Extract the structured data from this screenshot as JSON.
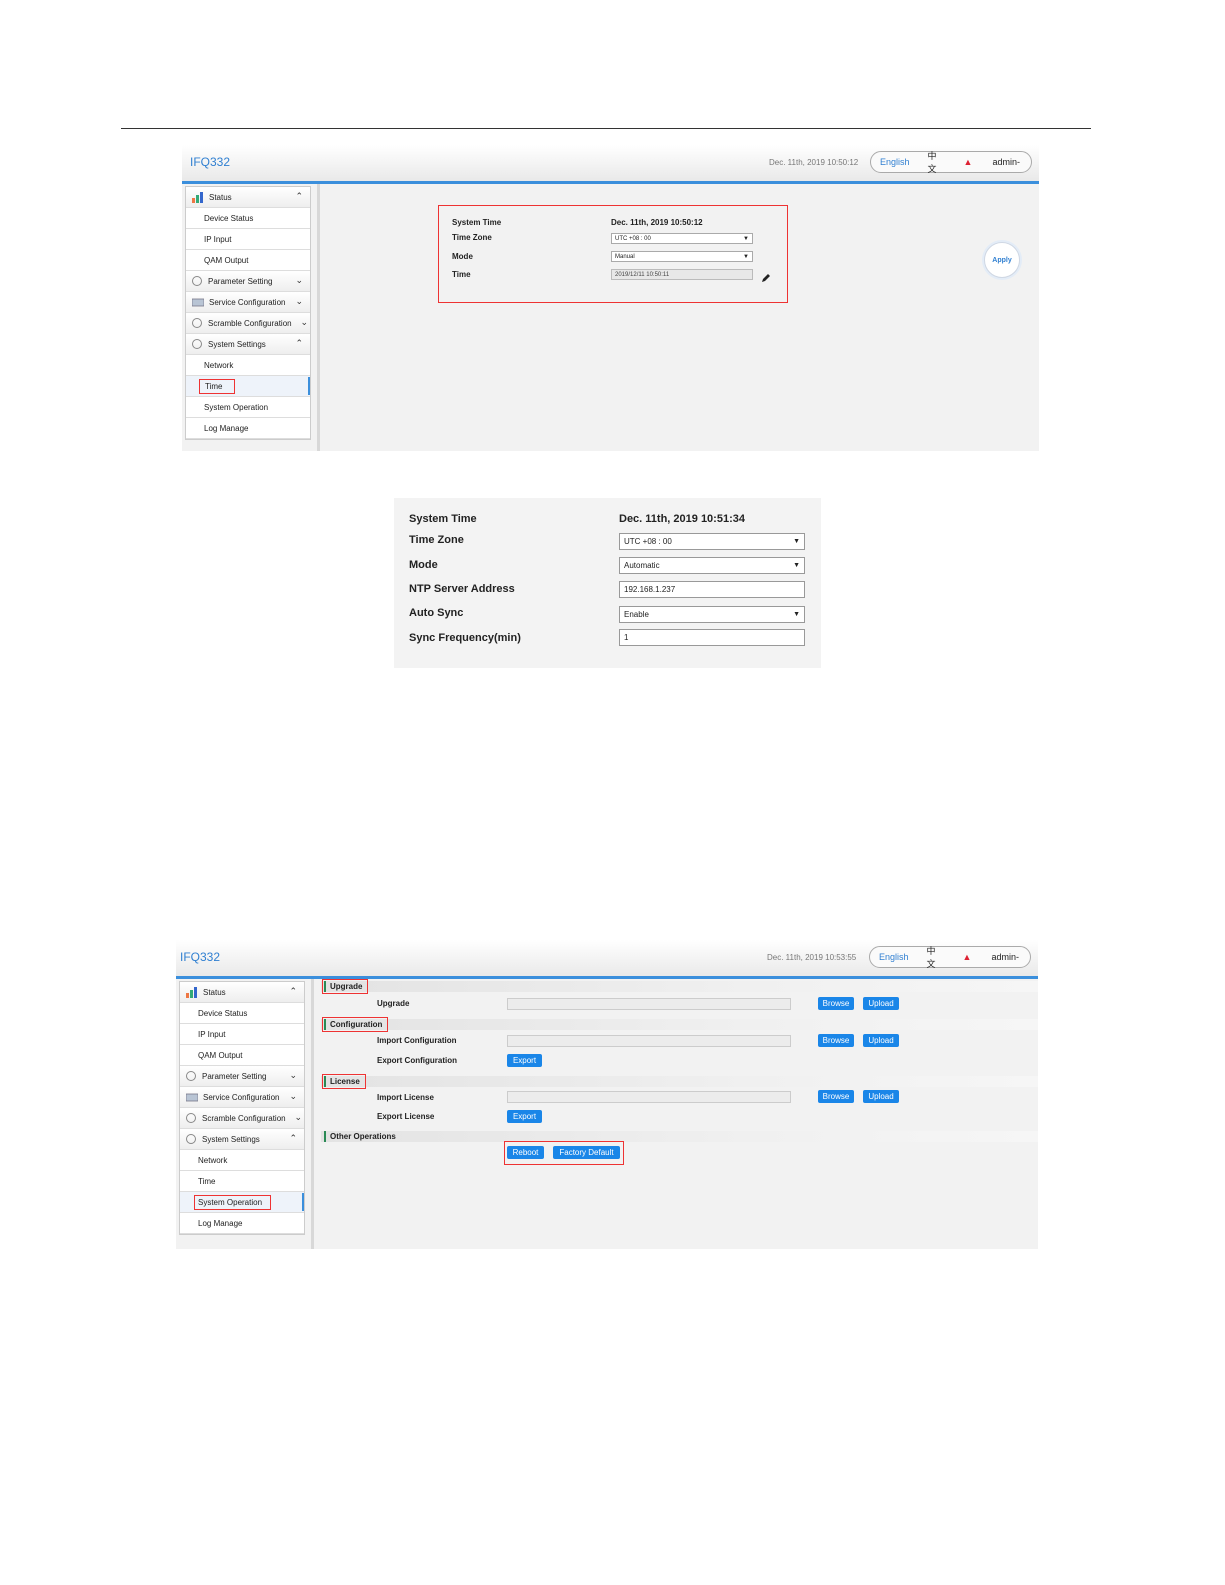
{
  "app": {
    "product": "IFQ332",
    "language_en": "English",
    "language_zh": "中文",
    "user": "admin-"
  },
  "sidebar": {
    "status": "Status",
    "device_status": "Device Status",
    "ip_input": "IP Input",
    "qam_output": "QAM Output",
    "parameter_setting": "Parameter Setting",
    "service_configuration": "Service Configuration",
    "scramble_configuration": "Scramble Configuration",
    "system_settings": "System Settings",
    "network": "Network",
    "time": "Time",
    "system_operation": "System Operation",
    "log_manage": "Log Manage"
  },
  "time_screen": {
    "header_date": "Dec. 11th, 2019 10:50:12",
    "system_time_label": "System Time",
    "system_time_value": "Dec. 11th, 2019 10:50:12",
    "time_zone_label": "Time Zone",
    "time_zone_value": "UTC +08 : 00",
    "mode_label": "Mode",
    "mode_value": "Manual",
    "time_label": "Time",
    "time_value": "2019/12/11 10:50:11",
    "apply_label": "Apply"
  },
  "auto_panel": {
    "system_time_label": "System Time",
    "system_time_value": "Dec. 11th, 2019 10:51:34",
    "time_zone_label": "Time Zone",
    "time_zone_value": "UTC +08 : 00",
    "mode_label": "Mode",
    "mode_value": "Automatic",
    "ntp_label": "NTP Server Address",
    "ntp_value": "192.168.1.237",
    "auto_sync_label": "Auto Sync",
    "auto_sync_value": "Enable",
    "sync_freq_label": "Sync Frequency(min)",
    "sync_freq_value": "1"
  },
  "ops_screen": {
    "header_date": "Dec. 11th, 2019 10:53:55",
    "upgrade_section": "Upgrade",
    "upgrade_label": "Upgrade",
    "configuration_section": "Configuration",
    "import_config_label": "Import Configuration",
    "export_config_label": "Export Configuration",
    "license_section": "License",
    "import_license_label": "Import License",
    "export_license_label": "Export License",
    "other_section": "Other Operations",
    "browse": "Browse",
    "upload": "Upload",
    "export": "Export",
    "reboot": "Reboot",
    "factory_default": "Factory Default"
  },
  "colors": {
    "accent": "#3b8fdc",
    "button": "#1a86e8",
    "highlight": "#e33333",
    "section_marker": "#2a8a55"
  }
}
